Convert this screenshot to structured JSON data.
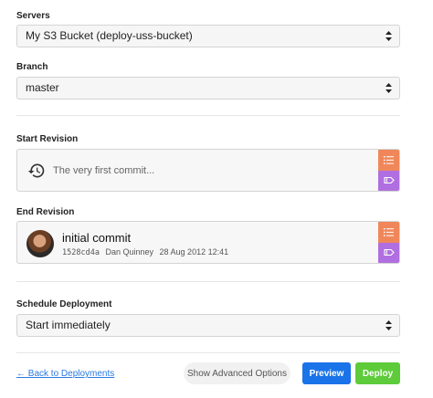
{
  "servers": {
    "label": "Servers",
    "value": "My S3 Bucket (deploy-uss-bucket)"
  },
  "branch": {
    "label": "Branch",
    "value": "master"
  },
  "start_revision": {
    "label": "Start Revision",
    "placeholder": "The very first commit..."
  },
  "end_revision": {
    "label": "End Revision",
    "commit_title": "initial commit",
    "sha": "1528cd4a",
    "author": "Dan Quinney",
    "date": "28 Aug 2012 12:41"
  },
  "schedule": {
    "label": "Schedule Deployment",
    "value": "Start immediately"
  },
  "footer": {
    "back_label": "← Back to Deployments",
    "advanced_label": "Show Advanced Options",
    "preview_label": "Preview",
    "deploy_label": "Deploy"
  },
  "colors": {
    "primary": "#1a73e8",
    "success": "#5dcb3a",
    "list_button": "#f0875a",
    "tag_button": "#b06fe0",
    "link": "#2a7ae2"
  },
  "icons": {
    "select_arrows": "up-down-arrows-icon",
    "history": "history-icon",
    "list": "list-icon",
    "tag": "tag-icon"
  }
}
